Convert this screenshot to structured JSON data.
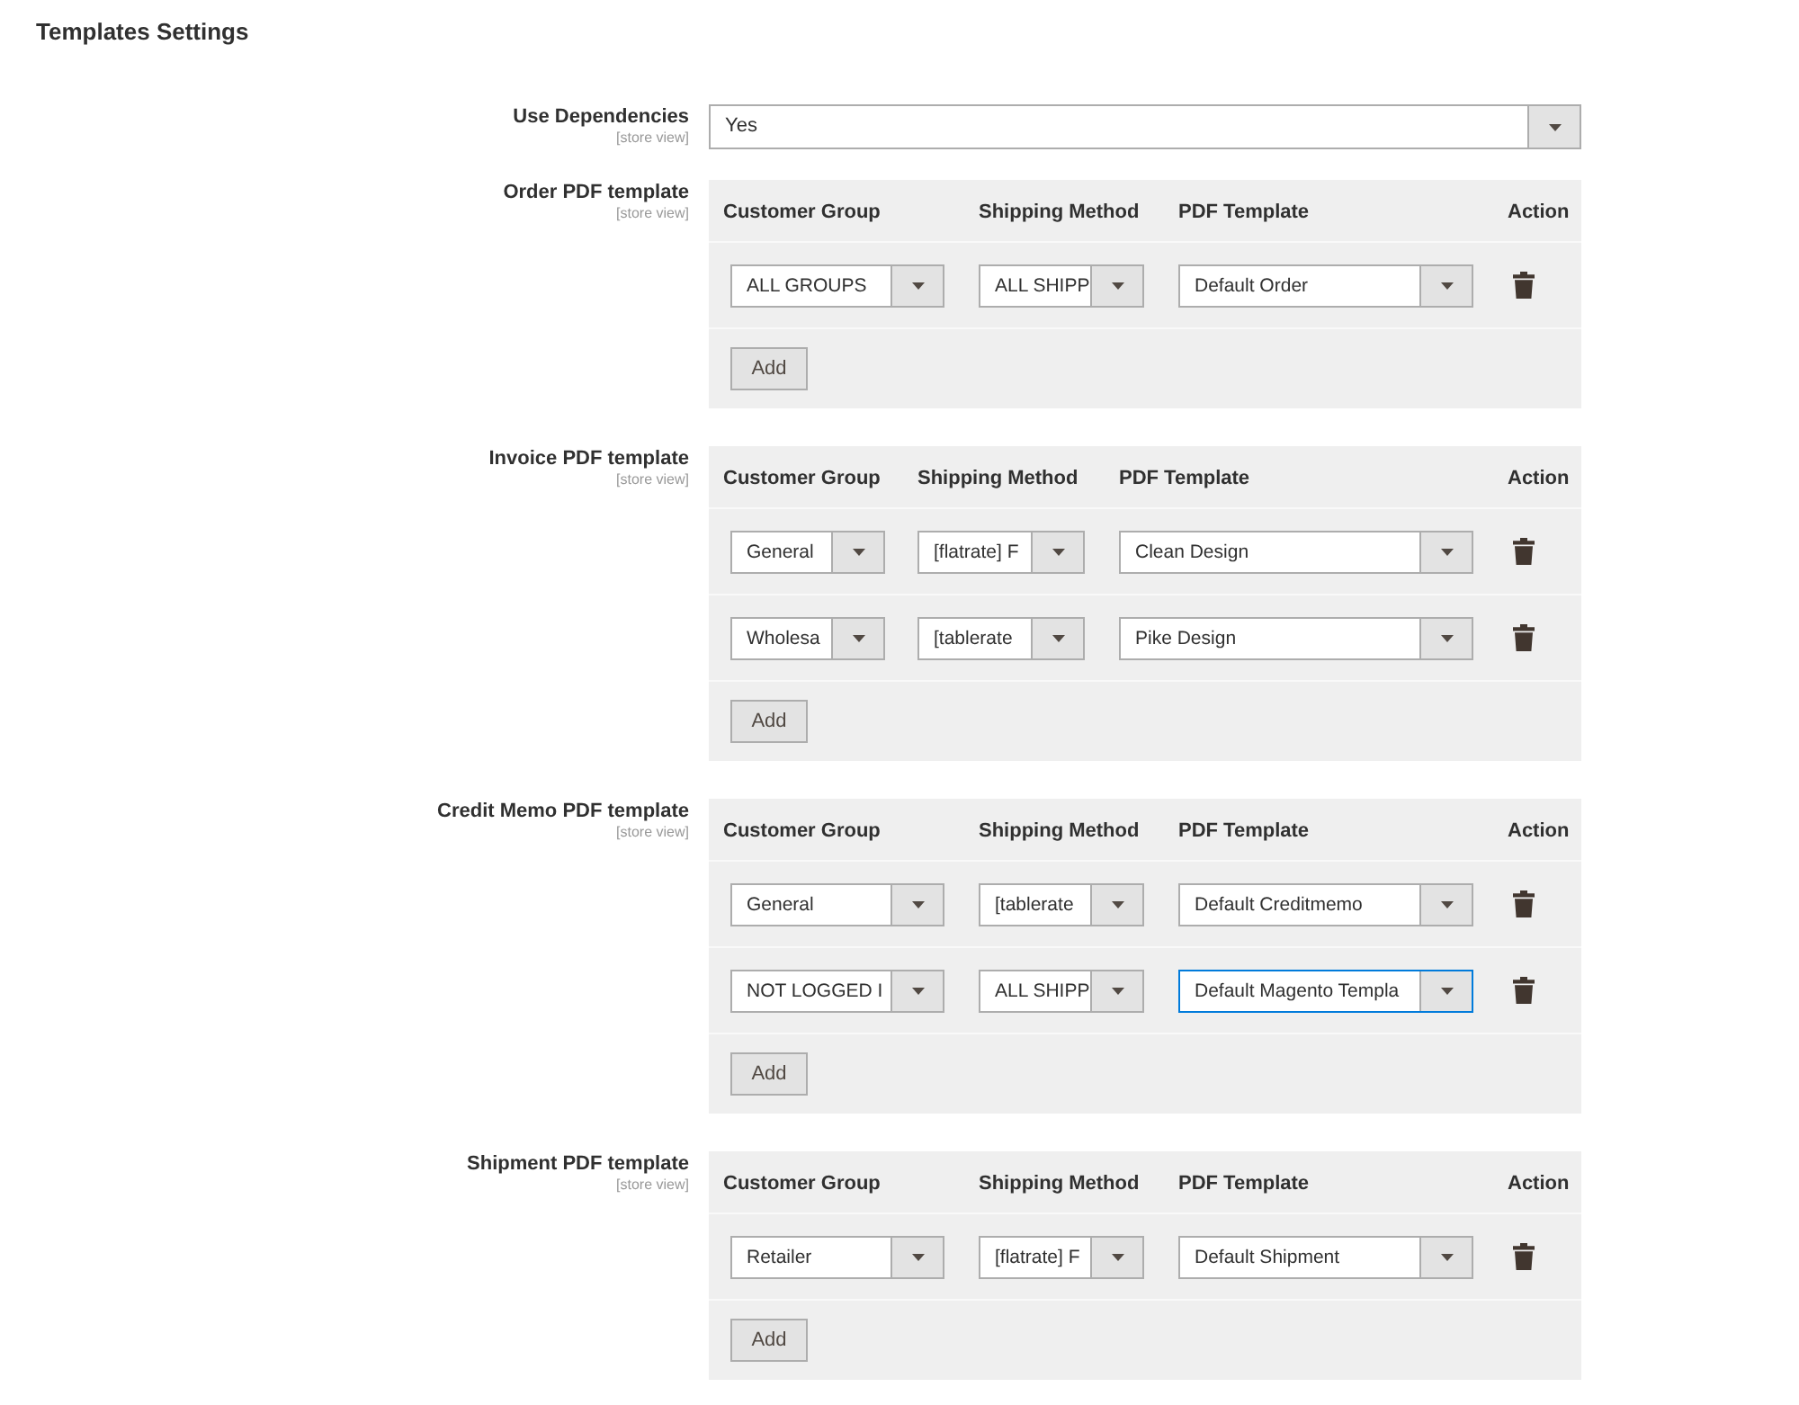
{
  "title": "Templates Settings",
  "use_dependencies": {
    "label": "Use Dependencies",
    "scope": "[store view]",
    "value": "Yes",
    "focused": false
  },
  "sections": [
    {
      "label": "Order PDF template",
      "scope": "[store view]",
      "columns": [
        "Customer Group",
        "Shipping Method",
        "PDF Template",
        "Action"
      ],
      "rows": [
        {
          "customer_group": {
            "value": "ALL GROUPS",
            "focused": false
          },
          "shipping_method": {
            "value": "ALL SHIPP",
            "focused": false
          },
          "pdf_template": {
            "value": "Default Order",
            "focused": false
          }
        }
      ],
      "add_button": "Add"
    },
    {
      "label": "Invoice PDF template",
      "scope": "[store view]",
      "columns": [
        "Customer Group",
        "Shipping Method",
        "PDF Template",
        "Action"
      ],
      "rows": [
        {
          "customer_group": {
            "value": "General",
            "focused": false
          },
          "shipping_method": {
            "value": "[flatrate] F",
            "focused": false
          },
          "pdf_template": {
            "value": "Clean Design",
            "focused": false
          }
        },
        {
          "customer_group": {
            "value": "Wholesa",
            "focused": false
          },
          "shipping_method": {
            "value": "[tablerate",
            "focused": false
          },
          "pdf_template": {
            "value": "Pike Design",
            "focused": false
          }
        }
      ],
      "add_button": "Add"
    },
    {
      "label": "Credit Memo PDF template",
      "scope": "[store view]",
      "columns": [
        "Customer Group",
        "Shipping Method",
        "PDF Template",
        "Action"
      ],
      "rows": [
        {
          "customer_group": {
            "value": "General",
            "focused": false
          },
          "shipping_method": {
            "value": "[tablerate",
            "focused": false
          },
          "pdf_template": {
            "value": "Default Creditmemo",
            "focused": false
          }
        },
        {
          "customer_group": {
            "value": "NOT LOGGED I",
            "focused": false
          },
          "shipping_method": {
            "value": "ALL SHIPP",
            "focused": false
          },
          "pdf_template": {
            "value": "Default Magento Templa",
            "focused": true
          }
        }
      ],
      "add_button": "Add"
    },
    {
      "label": "Shipment PDF template",
      "scope": "[store view]",
      "columns": [
        "Customer Group",
        "Shipping Method",
        "PDF Template",
        "Action"
      ],
      "rows": [
        {
          "customer_group": {
            "value": "Retailer",
            "focused": false
          },
          "shipping_method": {
            "value": "[flatrate] F",
            "focused": false
          },
          "pdf_template": {
            "value": "Default Shipment",
            "focused": false
          }
        }
      ],
      "add_button": "Add"
    }
  ]
}
